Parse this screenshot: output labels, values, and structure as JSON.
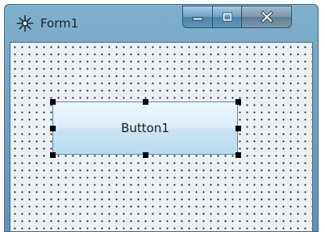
{
  "window": {
    "title": "Form1",
    "controls": {
      "minimize": "minimize",
      "maximize": "maximize",
      "close": "close"
    }
  },
  "form": {
    "button_label": "Button1",
    "selection_handles": 8
  },
  "colors": {
    "frame": "#6b9ec0",
    "client_background": "#eef1f4",
    "grid_dots": "#1a1a1a",
    "handle": "#000000"
  }
}
